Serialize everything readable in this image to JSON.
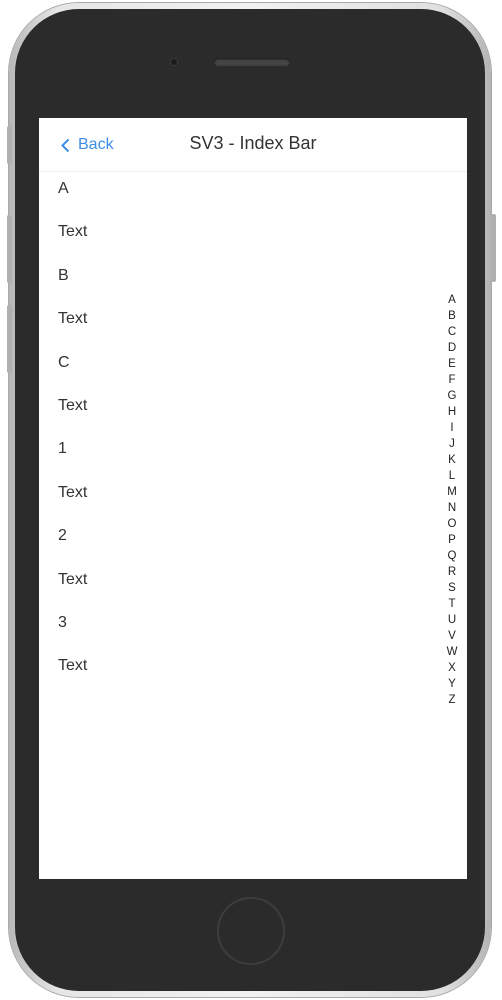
{
  "navbar": {
    "back_label": "Back",
    "title": "SV3 - Index Bar"
  },
  "list": [
    {
      "text": "A",
      "kind": "header"
    },
    {
      "text": "Text",
      "kind": "item"
    },
    {
      "text": "B",
      "kind": "header"
    },
    {
      "text": "Text",
      "kind": "item"
    },
    {
      "text": "C",
      "kind": "header"
    },
    {
      "text": "Text",
      "kind": "item"
    },
    {
      "text": "1",
      "kind": "header"
    },
    {
      "text": "Text",
      "kind": "item"
    },
    {
      "text": "2",
      "kind": "header"
    },
    {
      "text": "Text",
      "kind": "item"
    },
    {
      "text": "3",
      "kind": "header"
    },
    {
      "text": "Text",
      "kind": "item"
    }
  ],
  "index_bar": [
    "A",
    "B",
    "C",
    "D",
    "E",
    "F",
    "G",
    "H",
    "I",
    "J",
    "K",
    "L",
    "M",
    "N",
    "O",
    "P",
    "Q",
    "R",
    "S",
    "T",
    "U",
    "V",
    "W",
    "X",
    "Y",
    "Z"
  ],
  "colors": {
    "accent": "#3c8ee6",
    "text": "#333333",
    "device_body": "#2b2b2b"
  }
}
